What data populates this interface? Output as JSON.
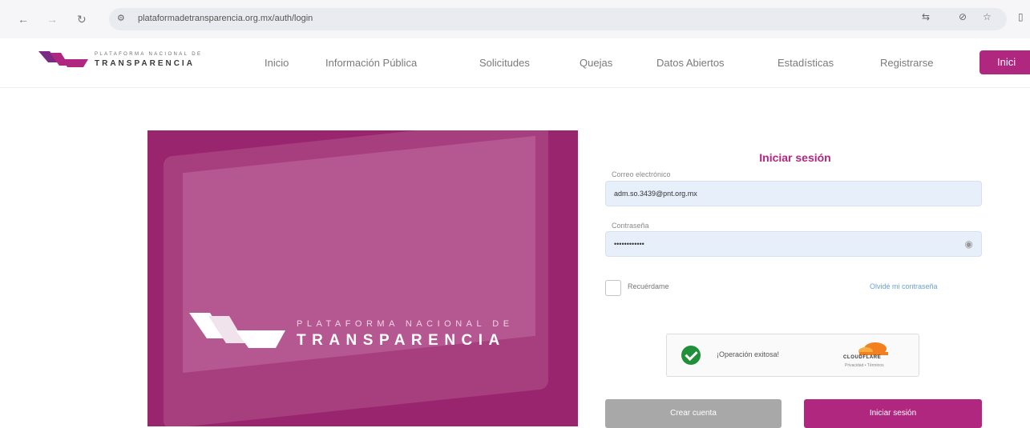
{
  "browser": {
    "url": "plataformadetransparencia.org.mx/auth/login"
  },
  "header": {
    "logo_top": "PLATAFORMA NACIONAL DE",
    "logo_main": "TRANSPARENCIA",
    "nav": [
      "Inicio",
      "Información Pública",
      "Solicitudes",
      "Quejas",
      "Datos Abiertos",
      "Estadísticas",
      "Registrarse"
    ],
    "login_label": "Inici"
  },
  "hero": {
    "subtitle": "PLATAFORMA NACIONAL DE",
    "title": "TRANSPARENCIA"
  },
  "form": {
    "title": "Iniciar sesión",
    "email_label": "Correo electrónico",
    "email_value": "adm.so.3439@pnt.org.mx",
    "password_label": "Contraseña",
    "password_value": "••••••••••••",
    "remember_label": "Recuérdame",
    "forgot_label": "Olvidé mi contraseña",
    "captcha_text": "¡Operación exitosa!",
    "captcha_brand": "CLOUDFLARE",
    "captcha_links": "Privacidad • Términos",
    "create_account_label": "Crear cuenta",
    "login_button_label": "Iniciar sesión"
  },
  "colors": {
    "brand": "#b0277f",
    "field_bg": "#e7effb",
    "link": "#6aa1d8",
    "success": "#1f8f3a"
  },
  "icons": [
    "back-icon",
    "forward-icon",
    "reload-icon",
    "site-info-icon",
    "translate-icon",
    "eye-off-icon",
    "star-icon",
    "sidebar-icon",
    "eye-icon",
    "check-icon",
    "cloudflare-logo"
  ]
}
